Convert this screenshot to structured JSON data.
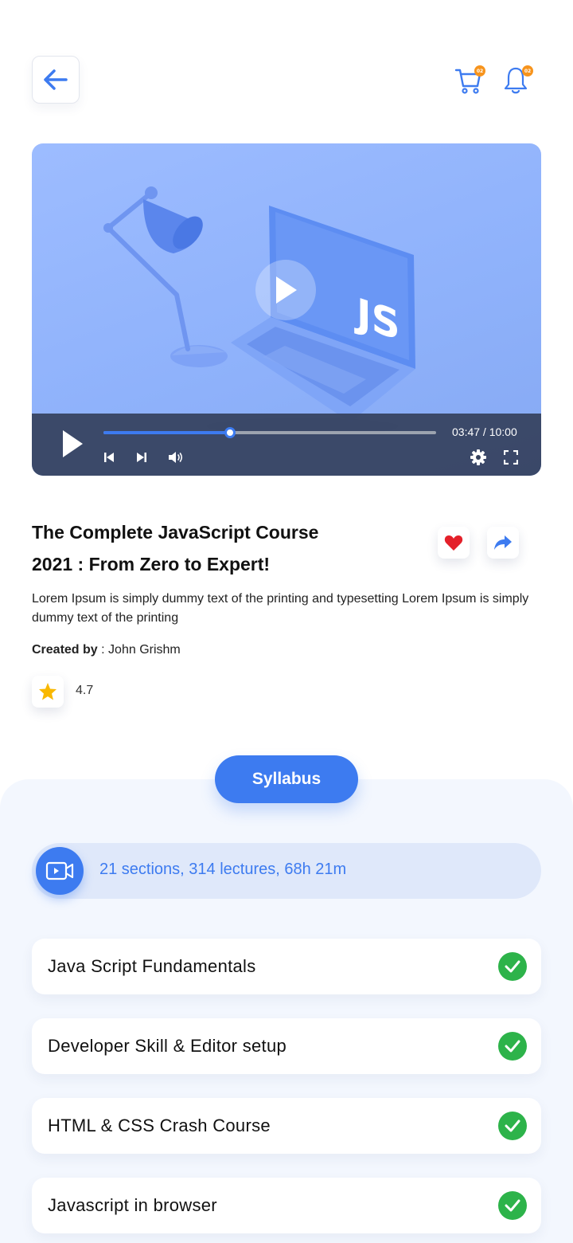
{
  "header": {
    "back_icon": "arrow-left-icon",
    "cart_badge": "02",
    "bell_badge": "02",
    "accent_color": "#3d7bf0",
    "badge_color": "#f7941d"
  },
  "video": {
    "current_time": "03:47",
    "duration": "10:00",
    "time_display": "03:47 / 10:00",
    "progress_fraction": 0.38,
    "thumbnail_text": "JS"
  },
  "course": {
    "title_line1": "The Complete JavaScript Course",
    "title_line2": "2021 : From Zero to Expert!",
    "description": "Lorem Ipsum is simply dummy text of the printing and typesetting Lorem Ipsum is simply dummy text of the printing",
    "created_by_label": "Created by",
    "created_by_sep": " : ",
    "author": "John Grishm",
    "rating": "4.7"
  },
  "syllabus": {
    "tab_label": "Syllabus",
    "summary": "21 sections, 314 lectures, 68h 21m",
    "sections": [
      {
        "label": "Java Script Fundamentals",
        "completed": true
      },
      {
        "label": "Developer Skill & Editor setup",
        "completed": true
      },
      {
        "label": "HTML & CSS Crash Course",
        "completed": true
      },
      {
        "label": "Javascript in browser",
        "completed": true
      }
    ],
    "check_color": "#2db34a"
  }
}
